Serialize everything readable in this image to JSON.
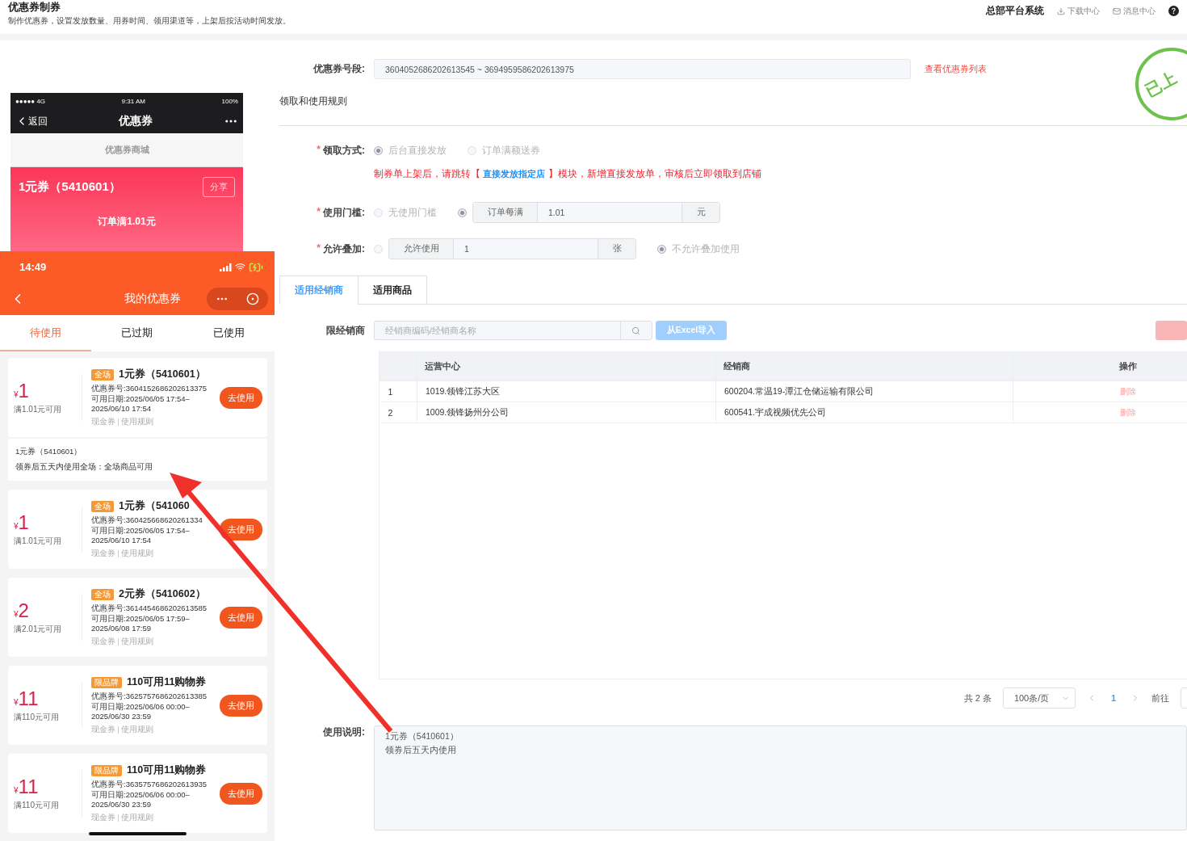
{
  "header": {
    "title": "优惠券制券",
    "subtitle": "制作优惠券，设置发放数量、用券时间、领用渠道等，上架后按活动时间发放。",
    "system": "总部平台系统",
    "links": [
      {
        "kind": "download",
        "label": "下载中心"
      },
      {
        "kind": "mail",
        "label": "消息中心"
      }
    ]
  },
  "old_phone": {
    "carrier": "●●●●● 4G",
    "time": "9:31 AM",
    "battery": "100%",
    "back": "返回",
    "title": "优惠券",
    "mall": "优惠券商城",
    "card": {
      "title": "1元券（5410601）",
      "share": "分享",
      "condition": "订单满1.01元"
    }
  },
  "phone": {
    "time": "14:49",
    "title": "我的优惠券",
    "tabs": [
      {
        "label": "待使用",
        "selected": true
      },
      {
        "label": "已过期",
        "selected": false
      },
      {
        "label": "已使用",
        "selected": false
      }
    ],
    "items": [
      {
        "kind": "coupon",
        "currency": "¥",
        "amount": "1",
        "condition": "满1.01元可用",
        "tag": "全场",
        "title": "1元券（5410601）",
        "number": "优惠券号:3604152686202613375",
        "date_lines": [
          "可用日期:2025/06/05 17:54–",
          "2025/06/10 17:54"
        ],
        "type": "现金券",
        "rules": "使用规则",
        "button": "去使用"
      },
      {
        "kind": "detail",
        "title": "1元券（5410601）",
        "text": "领券后五天内使用全场：全场商品可用"
      },
      {
        "kind": "coupon",
        "currency": "¥",
        "amount": "1",
        "condition": "满1.01元可用",
        "tag": "全场",
        "title": "1元券（541060",
        "number": "优惠券号:360425668620261334",
        "date_lines": [
          "可用日期:2025/06/05 17:54–",
          "2025/06/10 17:54"
        ],
        "type": "现金券",
        "rules": "使用规则",
        "button": "去使用"
      },
      {
        "kind": "coupon",
        "currency": "¥",
        "amount": "2",
        "condition": "满2.01元可用",
        "tag": "全场",
        "title": "2元券（5410602）",
        "number": "优惠券号:3614454686202613585",
        "date_lines": [
          "可用日期:2025/06/05 17:59–",
          "2025/06/08 17:59"
        ],
        "type": "现金券",
        "rules": "使用规则",
        "button": "去使用"
      },
      {
        "kind": "coupon",
        "currency": "¥",
        "amount": "11",
        "condition": "满110元可用",
        "tag": "限品牌",
        "title": "110可用11购物券",
        "number": "优惠券号:3625757686202613385",
        "date_lines": [
          "可用日期:2025/06/06 00:00–",
          "2025/06/30 23:59"
        ],
        "type": "现金券",
        "rules": "使用规则",
        "button": "去使用"
      },
      {
        "kind": "coupon",
        "currency": "¥",
        "amount": "11",
        "condition": "满110元可用",
        "tag": "限品牌",
        "title": "110可用11购物券",
        "number": "优惠券号:3635757686202613935",
        "date_lines": [
          "可用日期:2025/06/06 00:00–",
          "2025/06/30 23:59"
        ],
        "type": "现金券",
        "rules": "使用规则",
        "button": "去使用"
      }
    ]
  },
  "stamp": "已上",
  "form": {
    "coupon_range": {
      "label": "优惠券号段:",
      "value": "3604052686202613545 ~ 3694959586202613975",
      "link": "查看优惠券列表"
    },
    "section_title": "领取和使用规则",
    "rows": [
      {
        "required_mark": "*",
        "label": "领取方式:",
        "options": [
          {
            "kind": "plain",
            "label": "后台直接发放",
            "selected": true
          },
          {
            "kind": "plain",
            "label": "订单满额送券",
            "selected": false
          }
        ],
        "note_before": "制券单上架后，请跳转【",
        "note_link": "直接发放指定店",
        "note_after": "】模块，新增直接发放单，审核后立即领取到店铺"
      },
      {
        "required_mark": "*",
        "label": "使用门槛:",
        "options": [
          {
            "kind": "plain",
            "label": "无使用门槛",
            "selected": false
          },
          {
            "kind": "input",
            "prefix": "订单每满",
            "value": "1.01",
            "suffix": "元",
            "selected": true
          }
        ]
      },
      {
        "required_mark": "*",
        "label": "允许叠加:",
        "options": [
          {
            "kind": "input",
            "prefix": "允许使用",
            "value": "1",
            "suffix": "张",
            "selected": false
          },
          {
            "kind": "plain",
            "label": "不允许叠加使用",
            "selected": true
          }
        ]
      }
    ],
    "tabs": [
      {
        "label": "适用经销商",
        "selected": true
      },
      {
        "label": "适用商品",
        "selected": false
      }
    ],
    "dealer_filter": {
      "label": "限经销商",
      "placeholder": "经销商编码/经销商名称",
      "import_button": "从Excel导入"
    },
    "table": {
      "columns": [
        "运营中心",
        "经销商",
        "操作"
      ],
      "rows": [
        {
          "index": "1",
          "center": "1019.领锋江苏大区",
          "dealer": "600204.常温19-潭江仓储运输有限公司",
          "action": "删除"
        },
        {
          "index": "2",
          "center": "1009.领锋扬州分公司",
          "dealer": "600541.宇成视频优先公司",
          "action": "删除"
        }
      ]
    },
    "pagination": {
      "total": "共 2 条",
      "page_size": "100条/页",
      "pages": [
        {
          "label": "1",
          "selected": true
        }
      ],
      "goto": "前往"
    },
    "usage": {
      "label": "使用说明:",
      "lines": [
        "1元券（5410601）",
        "领券后五天内使用"
      ]
    }
  }
}
